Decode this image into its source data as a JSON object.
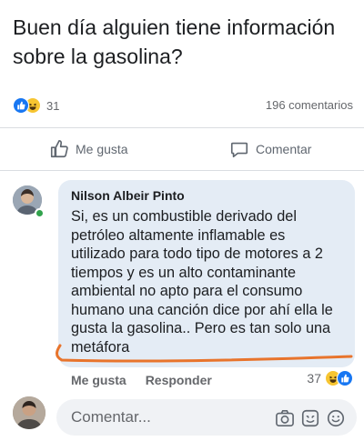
{
  "post": {
    "text": "Buen día alguien tiene información sobre la gasolina?",
    "reaction_count": "31",
    "comments_count": "196 comentarios"
  },
  "actions": {
    "like_label": "Me gusta",
    "comment_label": "Comentar"
  },
  "comment": {
    "author": "Nilson Albeir Pinto",
    "text": "Si, es un combustible derivado del petróleo altamente inflamable es utilizado para todo tipo de motores a 2 tiempos  y es un alto contaminante ambiental no apto para el consumo humano una canción dice por ahí ella le gusta la gasolina.. Pero es tan solo una metáfora",
    "like_label": "Me gusta",
    "reply_label": "Responder",
    "reaction_count": "37"
  },
  "composer": {
    "placeholder": "Comentar..."
  },
  "icons": {
    "like_reaction": "like-icon",
    "haha_reaction": "haha-icon",
    "thumbs_up": "thumbs-up-icon",
    "speech_bubble": "comment-icon",
    "camera": "camera-icon",
    "gif": "gif-icon",
    "emoji": "emoji-icon"
  },
  "colors": {
    "like_blue": "#1877f2",
    "haha_yellow": "#f7c531",
    "online_green": "#31a24c",
    "highlight_orange": "#e8742c"
  }
}
